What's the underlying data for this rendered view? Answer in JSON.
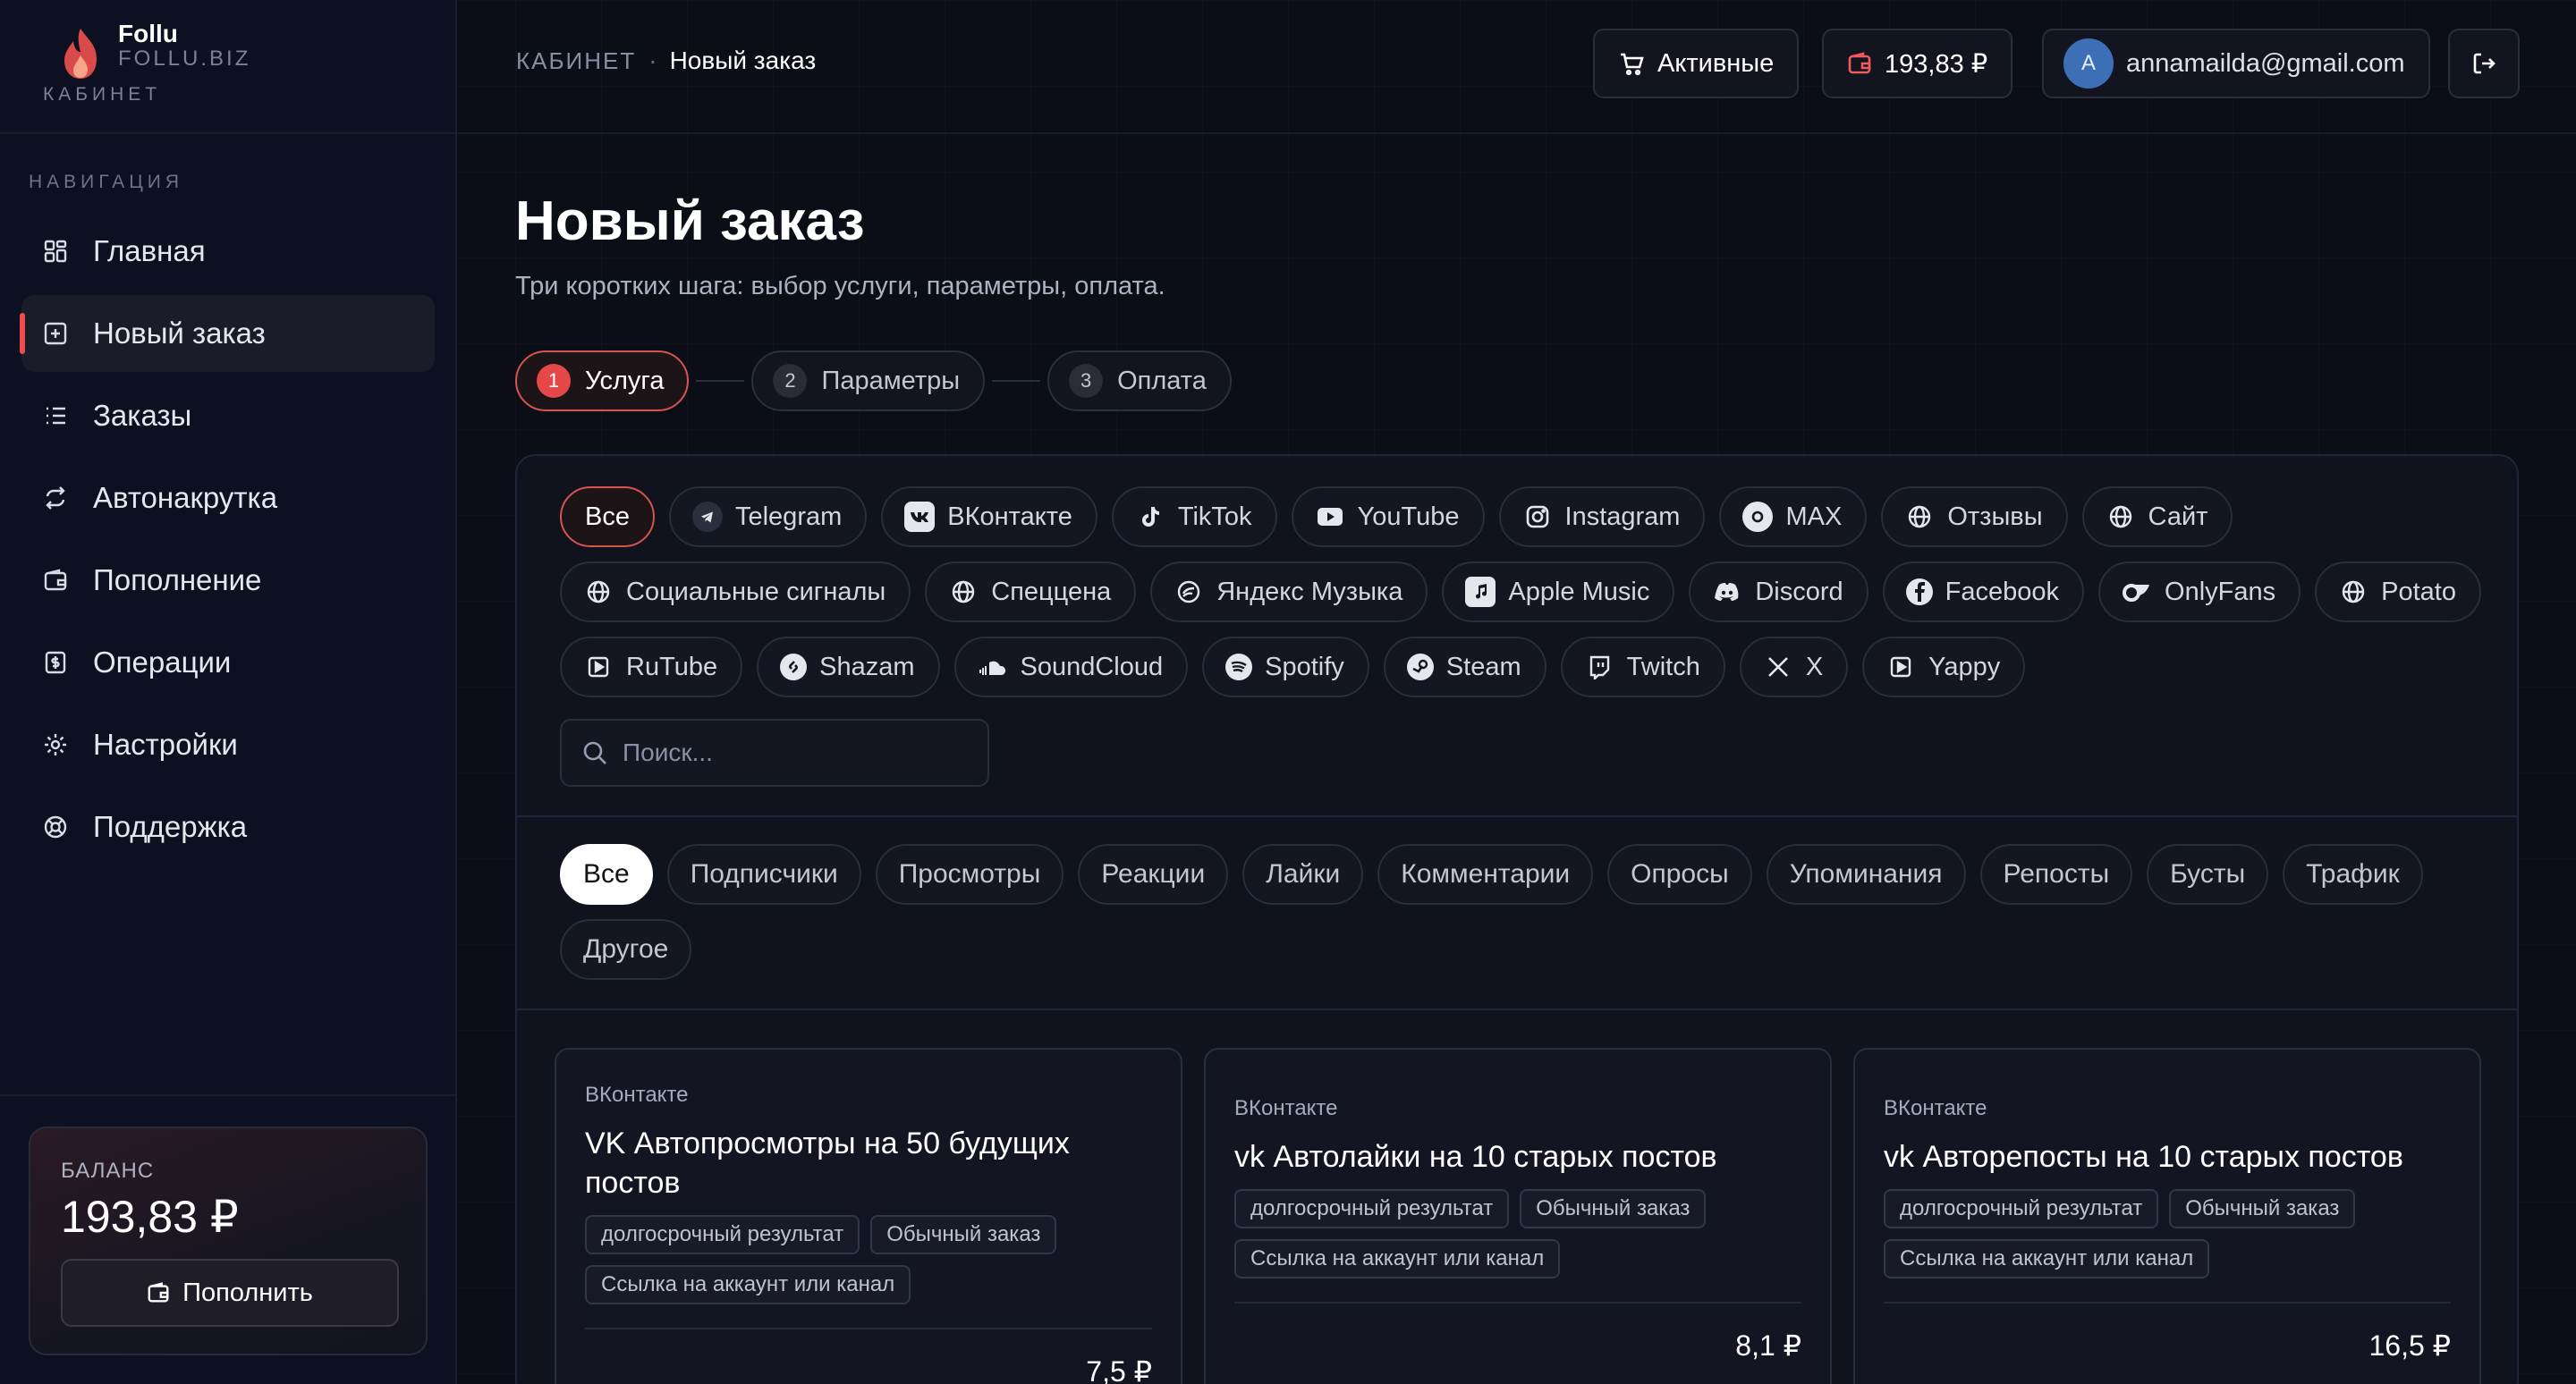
{
  "brand": {
    "name": "Follu",
    "domain": "FOLLU.BIZ",
    "subtitle": "КАБИНЕТ"
  },
  "nav": {
    "title": "НАВИГАЦИЯ",
    "items": [
      {
        "label": "Главная",
        "icon": "dashboard-icon"
      },
      {
        "label": "Новый заказ",
        "icon": "plus-square-icon",
        "active": true
      },
      {
        "label": "Заказы",
        "icon": "list-icon"
      },
      {
        "label": "Автонакрутка",
        "icon": "repeat-icon"
      },
      {
        "label": "Пополнение",
        "icon": "wallet-icon"
      },
      {
        "label": "Операции",
        "icon": "receipt-icon"
      },
      {
        "label": "Настройки",
        "icon": "gear-icon"
      },
      {
        "label": "Поддержка",
        "icon": "lifebuoy-icon"
      }
    ]
  },
  "balance": {
    "label": "БАЛАНС",
    "value": "193,83 ₽",
    "topup_label": "Пополнить"
  },
  "header": {
    "breadcrumb_root": "КАБИНЕТ",
    "breadcrumb_sep": "·",
    "breadcrumb_current": "Новый заказ",
    "active_label": "Активные",
    "balance": "193,83 ₽",
    "avatar_letter": "A",
    "email": "annamailda@gmail.com"
  },
  "page": {
    "title": "Новый заказ",
    "subtitle": "Три коротких шага: выбор услуги, параметры, оплата."
  },
  "steps": [
    {
      "num": "1",
      "label": "Услуга",
      "active": true
    },
    {
      "num": "2",
      "label": "Параметры"
    },
    {
      "num": "3",
      "label": "Оплата"
    }
  ],
  "platforms": [
    {
      "label": "Все",
      "active": true
    },
    {
      "label": "Telegram",
      "icon": "telegram-icon"
    },
    {
      "label": "ВКонтакте",
      "icon": "vk-icon"
    },
    {
      "label": "TikTok",
      "icon": "tiktok-icon"
    },
    {
      "label": "YouTube",
      "icon": "youtube-icon"
    },
    {
      "label": "Instagram",
      "icon": "instagram-icon"
    },
    {
      "label": "MAX",
      "icon": "max-icon"
    },
    {
      "label": "Отзывы",
      "icon": "globe-icon"
    },
    {
      "label": "Сайт",
      "icon": "globe-icon"
    },
    {
      "label": "Социальные сигналы",
      "icon": "globe-icon"
    },
    {
      "label": "Спеццена",
      "icon": "globe-icon"
    },
    {
      "label": "Яндекс Музыка",
      "icon": "yandex-music-icon"
    },
    {
      "label": "Apple Music",
      "icon": "apple-music-icon"
    },
    {
      "label": "Discord",
      "icon": "discord-icon"
    },
    {
      "label": "Facebook",
      "icon": "facebook-icon"
    },
    {
      "label": "OnlyFans",
      "icon": "onlyfans-icon"
    },
    {
      "label": "Potato",
      "icon": "globe-icon"
    },
    {
      "label": "RuTube",
      "icon": "rutube-icon"
    },
    {
      "label": "Shazam",
      "icon": "shazam-icon"
    },
    {
      "label": "SoundCloud",
      "icon": "soundcloud-icon"
    },
    {
      "label": "Spotify",
      "icon": "spotify-icon"
    },
    {
      "label": "Steam",
      "icon": "steam-icon"
    },
    {
      "label": "Twitch",
      "icon": "twitch-icon"
    },
    {
      "label": "X",
      "icon": "x-icon"
    },
    {
      "label": "Yappy",
      "icon": "yappy-icon"
    }
  ],
  "search": {
    "placeholder": "Поиск..."
  },
  "categories": [
    {
      "label": "Все",
      "active": true
    },
    {
      "label": "Подписчики"
    },
    {
      "label": "Просмотры"
    },
    {
      "label": "Реакции"
    },
    {
      "label": "Лайки"
    },
    {
      "label": "Комментарии"
    },
    {
      "label": "Опросы"
    },
    {
      "label": "Упоминания"
    },
    {
      "label": "Репосты"
    },
    {
      "label": "Бусты"
    },
    {
      "label": "Трафик"
    },
    {
      "label": "Другое"
    }
  ],
  "services": [
    {
      "category": "ВКонтакте",
      "title": "VK Автопросмотры на 50 будущих постов",
      "tags": [
        "долгосрочный результат",
        "Обычный заказ",
        "Ссылка на аккаунт или канал"
      ],
      "price": "7,5 ₽"
    },
    {
      "category": "ВКонтакте",
      "title": "vk Автолайки на 10 старых постов",
      "tags": [
        "долгосрочный результат",
        "Обычный заказ",
        "Ссылка на аккаунт или канал"
      ],
      "price": "8,1 ₽"
    },
    {
      "category": "ВКонтакте",
      "title": "vk Авторепосты на 10 старых постов",
      "tags": [
        "долгосрочный результат",
        "Обычный заказ",
        "Ссылка на аккаунт или канал"
      ],
      "price": "16,5 ₽"
    }
  ],
  "colors": {
    "accent": "#e6484a",
    "background": "#0b0d17",
    "panel": "#10121d"
  }
}
